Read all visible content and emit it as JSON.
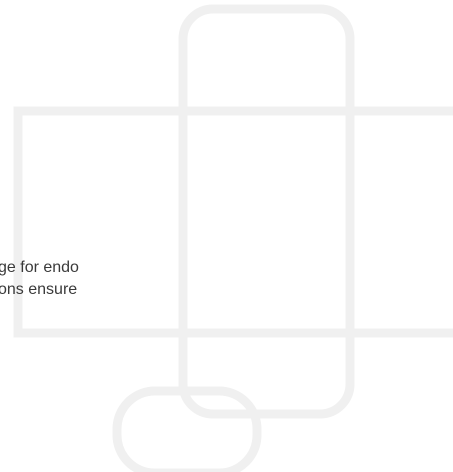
{
  "snippet": {
    "line1": "ge for endo",
    "line2": "ons ensure"
  },
  "colors": {
    "background": "#ffffff",
    "outline": "#f0f0f0",
    "text": "#3a3a3a"
  }
}
